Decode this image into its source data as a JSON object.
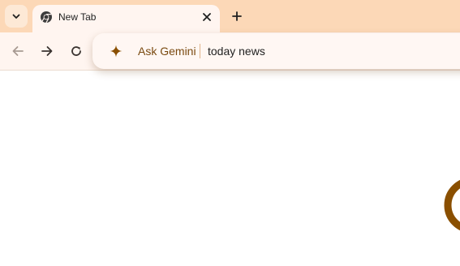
{
  "tab_strip": {
    "search_icon": "chevron-down-icon",
    "active_tab": {
      "favicon": "chrome-icon",
      "title": "New Tab",
      "close_icon": "close-icon"
    },
    "new_tab_icon": "plus-icon"
  },
  "toolbar": {
    "back_icon": "arrow-left-icon",
    "forward_icon": "arrow-right-icon",
    "reload_icon": "reload-icon"
  },
  "omnibox": {
    "icon": "gemini-sparkle-icon",
    "scope_label": "Ask Gemini",
    "query": "today news"
  },
  "colors": {
    "tabstrip_bg": "#fcd8b7",
    "toolbar_bg": "#fff5f0",
    "accent_brown": "#8a4f00"
  }
}
